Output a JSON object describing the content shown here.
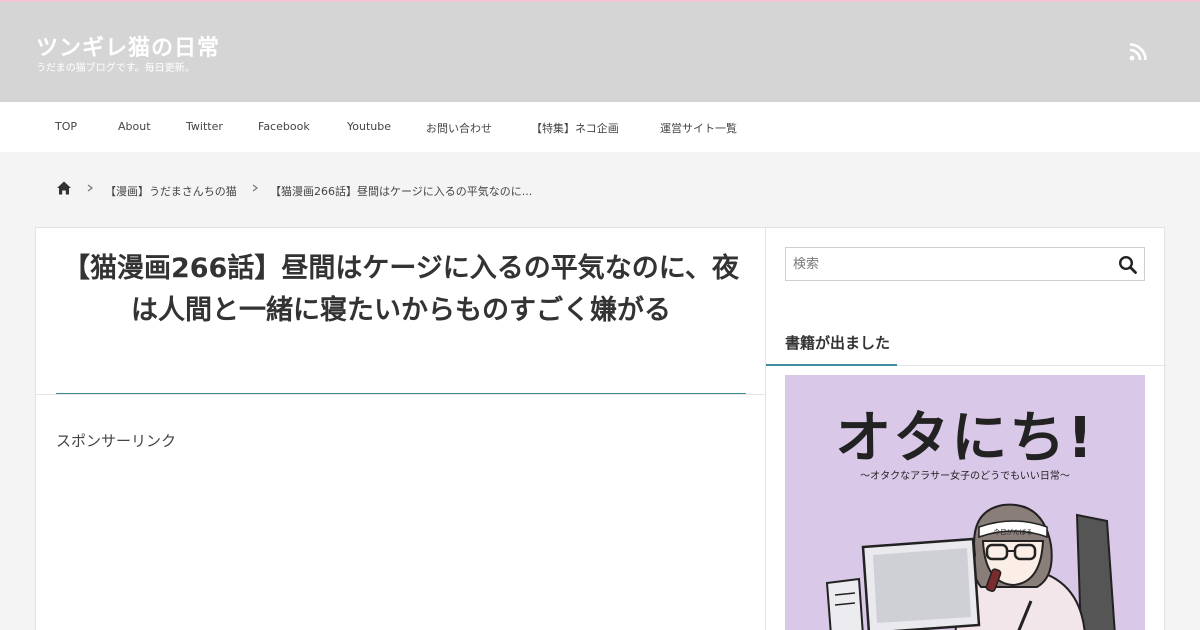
{
  "header": {
    "site_title": "ツンギレ猫の日常",
    "site_description": "うだまの猫ブログです。毎日更新。"
  },
  "nav": {
    "items": [
      {
        "label": "TOP"
      },
      {
        "label": "About"
      },
      {
        "label": "Twitter"
      },
      {
        "label": "Facebook"
      },
      {
        "label": "Youtube"
      },
      {
        "label": "お問い合わせ"
      },
      {
        "label": "【特集】ネコ企画"
      },
      {
        "label": "運営サイト一覧"
      }
    ]
  },
  "breadcrumb": {
    "category": "【漫画】うだまさんちの猫",
    "current": "【猫漫画266話】昼間はケージに入るの平気なのに..."
  },
  "article": {
    "title": "【猫漫画266話】昼間はケージに入るの平気なのに、夜は人間と一緒に寝たいからものすごく嫌がる",
    "sponsor_label": "スポンサーリンク"
  },
  "sidebar": {
    "search_placeholder": "検索",
    "widget_title": "書籍が出ました",
    "book": {
      "title": "オタにち!",
      "subtitle": "〜オタクなアラサー女子のどうでもいい日常〜",
      "headband_text": "今日がんばる"
    }
  },
  "colors": {
    "header_bg": "#d5d5d5",
    "accent": "#3f8e9e",
    "book_bg": "#d9c8e8"
  }
}
